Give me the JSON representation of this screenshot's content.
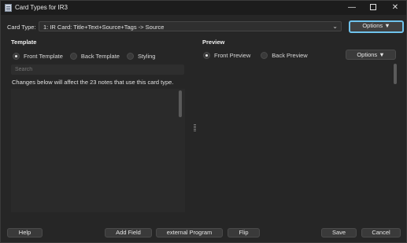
{
  "window": {
    "title": "Card Types for IR3"
  },
  "card_type": {
    "label": "Card Type:",
    "selected": "1: IR Card: Title+Text+Source+Tags -> Source",
    "options_button": "Options ▼"
  },
  "template": {
    "heading": "Template",
    "radios": [
      {
        "label": "Front Template",
        "checked": true
      },
      {
        "label": "Back Template",
        "checked": false
      },
      {
        "label": "Styling",
        "checked": false
      }
    ],
    "search_placeholder": "Search",
    "note": "Changes below will affect the 23 notes that use this card type."
  },
  "preview": {
    "heading": "Preview",
    "radios": [
      {
        "label": "Front Preview",
        "checked": true
      },
      {
        "label": "Back Preview",
        "checked": false
      }
    ],
    "options_button": "Options ▼"
  },
  "buttons": {
    "help": "Help",
    "add_field": "Add Field",
    "external_program": "external Program",
    "flip": "Flip",
    "save": "Save",
    "cancel": "Cancel"
  },
  "icons": {
    "minimize": "minimize-icon",
    "maximize": "maximize-icon",
    "close": "close-icon",
    "dropdown": "chevron-down-icon"
  },
  "colors": {
    "focus_ring": "#6fc2ec",
    "background": "#262626"
  }
}
